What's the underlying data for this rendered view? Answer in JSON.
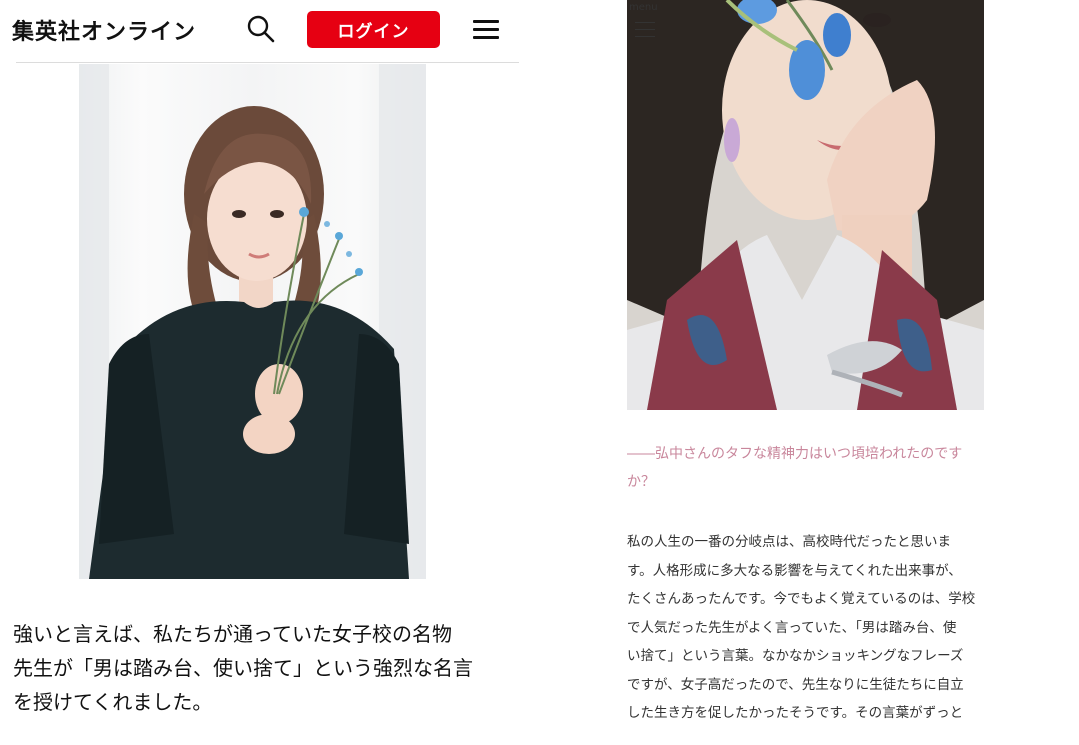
{
  "header": {
    "logo": "集英社オンライン",
    "login_label": "ログイン",
    "icons": {
      "search": "search-icon",
      "menu": "hamburger-menu-icon"
    },
    "accent_color": "#e60012"
  },
  "left_article": {
    "photo": "woman-in-black-dress-holding-flowers",
    "text_lines": [
      "強いと言えば、私たちが通っていた女子校の名物",
      "先生が「男は踏み台、使い捨て」という強烈な名言",
      "を授けてくれました。"
    ]
  },
  "right_article": {
    "menu_label": "menu",
    "photo": "woman-with-blue-flower-hand-on-cheek",
    "question_color": "#c9879c",
    "question_lines": [
      "――弘中さんのタフな精神力はいつ頃培われたのです",
      "か？"
    ],
    "answer_lines": [
      "私の人生の一番の分岐点は、高校時代だったと思いま",
      "す。人格形成に多大なる影響を与えてくれた出来事が、",
      "たくさんあったんです。今でもよく覚えているのは、学校",
      "で人気だった先生がよく言っていた、「男は踏み台、使",
      "い捨て」という言葉。なかなかショッキングなフレーズ",
      "ですが、女子高だったので、先生なりに生徒たちに自立",
      "した生き方を促したかったそうです。その言葉がずっと"
    ]
  }
}
